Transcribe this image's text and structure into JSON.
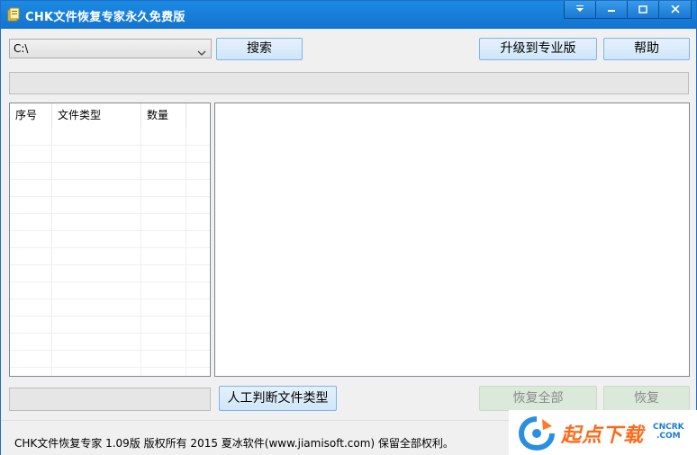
{
  "window": {
    "title": "CHK文件恢复专家永久免费版",
    "controls": {
      "menu_icon": "dropdown-icon",
      "minimize_icon": "minimize-icon",
      "maximize_icon": "maximize-icon",
      "close_icon": "close-icon"
    }
  },
  "toolbar": {
    "drive_value": "C:\\",
    "search_label": "搜索",
    "upgrade_label": "升级到专业版",
    "help_label": "帮助"
  },
  "file_list": {
    "columns": [
      "序号",
      "文件类型",
      "数量"
    ],
    "rows": []
  },
  "actions": {
    "manual_judge_label": "人工判断文件类型",
    "recover_all_label": "恢复全部",
    "recover_label": "恢复"
  },
  "footer": {
    "copyright": "CHK文件恢复专家 1.09版  版权所有 2015 夏冰软件(www.jiamisoft.com) 保留全部权利。"
  },
  "watermark": {
    "brand_name": "起点下载",
    "brand_tag_top": "CNCRK",
    "brand_tag_bottom": ".COM"
  },
  "colors": {
    "titlebar": "#1273cf",
    "button_border": "#7eb4ea",
    "button_fill": "#cfe6fa",
    "watermark_orange": "#ff6a1a"
  }
}
